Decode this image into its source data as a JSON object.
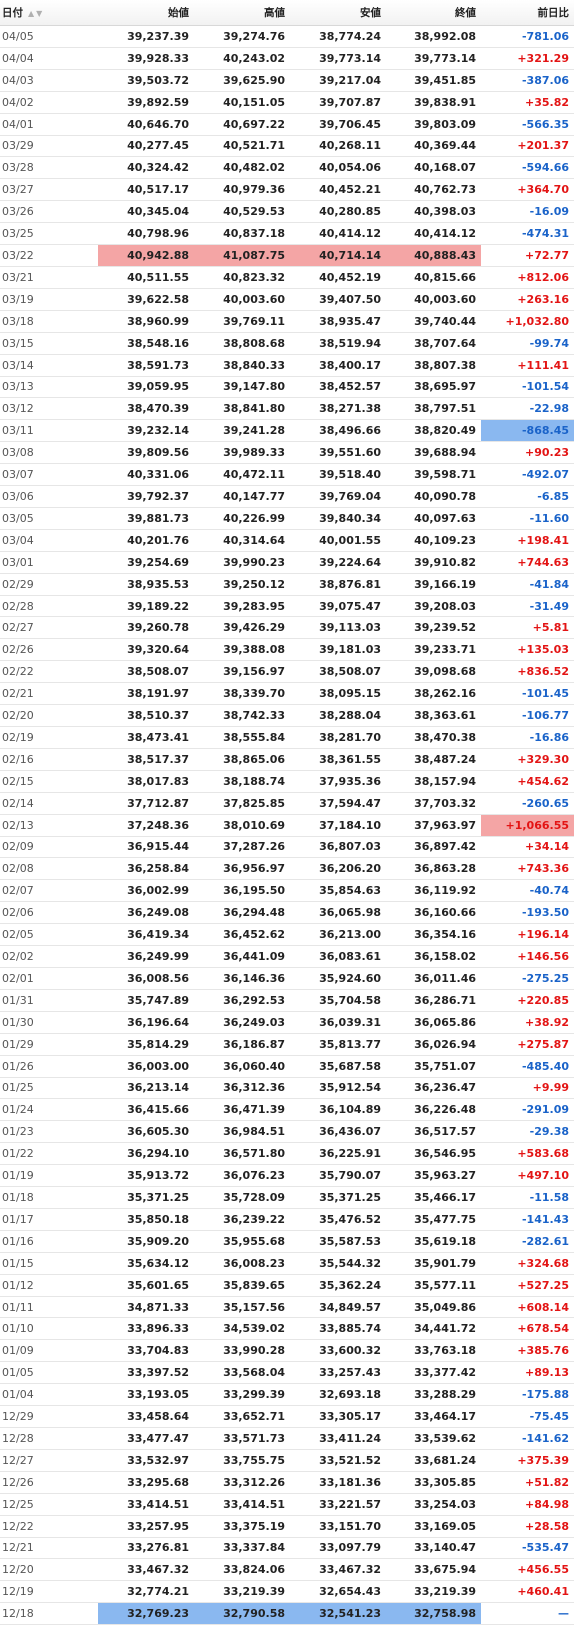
{
  "headers": {
    "date": "日付",
    "open": "始値",
    "high": "高値",
    "low": "安値",
    "close": "終値",
    "change": "前日比"
  },
  "sort_icons": [
    "sort-asc-icon",
    "sort-desc-icon"
  ],
  "colors": {
    "positive": "#e31414",
    "negative": "#1a63c9",
    "highlight_high": "#f4a5a5",
    "highlight_low": "#8ab8f0"
  },
  "rows": [
    {
      "date": "04/05",
      "open": "39,237.39",
      "high": "39,274.76",
      "low": "38,774.24",
      "close": "38,992.08",
      "change": "-781.06"
    },
    {
      "date": "04/04",
      "open": "39,928.33",
      "high": "40,243.02",
      "low": "39,773.14",
      "close": "39,773.14",
      "change": "+321.29"
    },
    {
      "date": "04/03",
      "open": "39,503.72",
      "high": "39,625.90",
      "low": "39,217.04",
      "close": "39,451.85",
      "change": "-387.06"
    },
    {
      "date": "04/02",
      "open": "39,892.59",
      "high": "40,151.05",
      "low": "39,707.87",
      "close": "39,838.91",
      "change": "+35.82"
    },
    {
      "date": "04/01",
      "open": "40,646.70",
      "high": "40,697.22",
      "low": "39,706.45",
      "close": "39,803.09",
      "change": "-566.35"
    },
    {
      "date": "03/29",
      "open": "40,277.45",
      "high": "40,521.71",
      "low": "40,268.11",
      "close": "40,369.44",
      "change": "+201.37"
    },
    {
      "date": "03/28",
      "open": "40,324.42",
      "high": "40,482.02",
      "low": "40,054.06",
      "close": "40,168.07",
      "change": "-594.66"
    },
    {
      "date": "03/27",
      "open": "40,517.17",
      "high": "40,979.36",
      "low": "40,452.21",
      "close": "40,762.73",
      "change": "+364.70"
    },
    {
      "date": "03/26",
      "open": "40,345.04",
      "high": "40,529.53",
      "low": "40,280.85",
      "close": "40,398.03",
      "change": "-16.09"
    },
    {
      "date": "03/25",
      "open": "40,798.96",
      "high": "40,837.18",
      "low": "40,414.12",
      "close": "40,414.12",
      "change": "-474.31"
    },
    {
      "date": "03/22",
      "open": "40,942.88",
      "high": "41,087.75",
      "low": "40,714.14",
      "close": "40,888.43",
      "change": "+72.77",
      "hl": "ohlc-red"
    },
    {
      "date": "03/21",
      "open": "40,511.55",
      "high": "40,823.32",
      "low": "40,452.19",
      "close": "40,815.66",
      "change": "+812.06"
    },
    {
      "date": "03/19",
      "open": "39,622.58",
      "high": "40,003.60",
      "low": "39,407.50",
      "close": "40,003.60",
      "change": "+263.16"
    },
    {
      "date": "03/18",
      "open": "38,960.99",
      "high": "39,769.11",
      "low": "38,935.47",
      "close": "39,740.44",
      "change": "+1,032.80"
    },
    {
      "date": "03/15",
      "open": "38,548.16",
      "high": "38,808.68",
      "low": "38,519.94",
      "close": "38,707.64",
      "change": "-99.74"
    },
    {
      "date": "03/14",
      "open": "38,591.73",
      "high": "38,840.33",
      "low": "38,400.17",
      "close": "38,807.38",
      "change": "+111.41"
    },
    {
      "date": "03/13",
      "open": "39,059.95",
      "high": "39,147.80",
      "low": "38,452.57",
      "close": "38,695.97",
      "change": "-101.54"
    },
    {
      "date": "03/12",
      "open": "38,470.39",
      "high": "38,841.80",
      "low": "38,271.38",
      "close": "38,797.51",
      "change": "-22.98"
    },
    {
      "date": "03/11",
      "open": "39,232.14",
      "high": "39,241.28",
      "low": "38,496.66",
      "close": "38,820.49",
      "change": "-868.45",
      "hl": "chg-blue"
    },
    {
      "date": "03/08",
      "open": "39,809.56",
      "high": "39,989.33",
      "low": "39,551.60",
      "close": "39,688.94",
      "change": "+90.23"
    },
    {
      "date": "03/07",
      "open": "40,331.06",
      "high": "40,472.11",
      "low": "39,518.40",
      "close": "39,598.71",
      "change": "-492.07"
    },
    {
      "date": "03/06",
      "open": "39,792.37",
      "high": "40,147.77",
      "low": "39,769.04",
      "close": "40,090.78",
      "change": "-6.85"
    },
    {
      "date": "03/05",
      "open": "39,881.73",
      "high": "40,226.99",
      "low": "39,840.34",
      "close": "40,097.63",
      "change": "-11.60"
    },
    {
      "date": "03/04",
      "open": "40,201.76",
      "high": "40,314.64",
      "low": "40,001.55",
      "close": "40,109.23",
      "change": "+198.41"
    },
    {
      "date": "03/01",
      "open": "39,254.69",
      "high": "39,990.23",
      "low": "39,224.64",
      "close": "39,910.82",
      "change": "+744.63"
    },
    {
      "date": "02/29",
      "open": "38,935.53",
      "high": "39,250.12",
      "low": "38,876.81",
      "close": "39,166.19",
      "change": "-41.84"
    },
    {
      "date": "02/28",
      "open": "39,189.22",
      "high": "39,283.95",
      "low": "39,075.47",
      "close": "39,208.03",
      "change": "-31.49"
    },
    {
      "date": "02/27",
      "open": "39,260.78",
      "high": "39,426.29",
      "low": "39,113.03",
      "close": "39,239.52",
      "change": "+5.81"
    },
    {
      "date": "02/26",
      "open": "39,320.64",
      "high": "39,388.08",
      "low": "39,181.03",
      "close": "39,233.71",
      "change": "+135.03"
    },
    {
      "date": "02/22",
      "open": "38,508.07",
      "high": "39,156.97",
      "low": "38,508.07",
      "close": "39,098.68",
      "change": "+836.52"
    },
    {
      "date": "02/21",
      "open": "38,191.97",
      "high": "38,339.70",
      "low": "38,095.15",
      "close": "38,262.16",
      "change": "-101.45"
    },
    {
      "date": "02/20",
      "open": "38,510.37",
      "high": "38,742.33",
      "low": "38,288.04",
      "close": "38,363.61",
      "change": "-106.77"
    },
    {
      "date": "02/19",
      "open": "38,473.41",
      "high": "38,555.84",
      "low": "38,281.70",
      "close": "38,470.38",
      "change": "-16.86"
    },
    {
      "date": "02/16",
      "open": "38,517.37",
      "high": "38,865.06",
      "low": "38,361.55",
      "close": "38,487.24",
      "change": "+329.30"
    },
    {
      "date": "02/15",
      "open": "38,017.83",
      "high": "38,188.74",
      "low": "37,935.36",
      "close": "38,157.94",
      "change": "+454.62"
    },
    {
      "date": "02/14",
      "open": "37,712.87",
      "high": "37,825.85",
      "low": "37,594.47",
      "close": "37,703.32",
      "change": "-260.65"
    },
    {
      "date": "02/13",
      "open": "37,248.36",
      "high": "38,010.69",
      "low": "37,184.10",
      "close": "37,963.97",
      "change": "+1,066.55",
      "hl": "chg-red"
    },
    {
      "date": "02/09",
      "open": "36,915.44",
      "high": "37,287.26",
      "low": "36,807.03",
      "close": "36,897.42",
      "change": "+34.14"
    },
    {
      "date": "02/08",
      "open": "36,258.84",
      "high": "36,956.97",
      "low": "36,206.20",
      "close": "36,863.28",
      "change": "+743.36"
    },
    {
      "date": "02/07",
      "open": "36,002.99",
      "high": "36,195.50",
      "low": "35,854.63",
      "close": "36,119.92",
      "change": "-40.74"
    },
    {
      "date": "02/06",
      "open": "36,249.08",
      "high": "36,294.48",
      "low": "36,065.98",
      "close": "36,160.66",
      "change": "-193.50"
    },
    {
      "date": "02/05",
      "open": "36,419.34",
      "high": "36,452.62",
      "low": "36,213.00",
      "close": "36,354.16",
      "change": "+196.14"
    },
    {
      "date": "02/02",
      "open": "36,249.99",
      "high": "36,441.09",
      "low": "36,083.61",
      "close": "36,158.02",
      "change": "+146.56"
    },
    {
      "date": "02/01",
      "open": "36,008.56",
      "high": "36,146.36",
      "low": "35,924.60",
      "close": "36,011.46",
      "change": "-275.25"
    },
    {
      "date": "01/31",
      "open": "35,747.89",
      "high": "36,292.53",
      "low": "35,704.58",
      "close": "36,286.71",
      "change": "+220.85"
    },
    {
      "date": "01/30",
      "open": "36,196.64",
      "high": "36,249.03",
      "low": "36,039.31",
      "close": "36,065.86",
      "change": "+38.92"
    },
    {
      "date": "01/29",
      "open": "35,814.29",
      "high": "36,186.87",
      "low": "35,813.77",
      "close": "36,026.94",
      "change": "+275.87"
    },
    {
      "date": "01/26",
      "open": "36,003.00",
      "high": "36,060.40",
      "low": "35,687.58",
      "close": "35,751.07",
      "change": "-485.40"
    },
    {
      "date": "01/25",
      "open": "36,213.14",
      "high": "36,312.36",
      "low": "35,912.54",
      "close": "36,236.47",
      "change": "+9.99"
    },
    {
      "date": "01/24",
      "open": "36,415.66",
      "high": "36,471.39",
      "low": "36,104.89",
      "close": "36,226.48",
      "change": "-291.09"
    },
    {
      "date": "01/23",
      "open": "36,605.30",
      "high": "36,984.51",
      "low": "36,436.07",
      "close": "36,517.57",
      "change": "-29.38"
    },
    {
      "date": "01/22",
      "open": "36,294.10",
      "high": "36,571.80",
      "low": "36,225.91",
      "close": "36,546.95",
      "change": "+583.68"
    },
    {
      "date": "01/19",
      "open": "35,913.72",
      "high": "36,076.23",
      "low": "35,790.07",
      "close": "35,963.27",
      "change": "+497.10"
    },
    {
      "date": "01/18",
      "open": "35,371.25",
      "high": "35,728.09",
      "low": "35,371.25",
      "close": "35,466.17",
      "change": "-11.58"
    },
    {
      "date": "01/17",
      "open": "35,850.18",
      "high": "36,239.22",
      "low": "35,476.52",
      "close": "35,477.75",
      "change": "-141.43"
    },
    {
      "date": "01/16",
      "open": "35,909.20",
      "high": "35,955.68",
      "low": "35,587.53",
      "close": "35,619.18",
      "change": "-282.61"
    },
    {
      "date": "01/15",
      "open": "35,634.12",
      "high": "36,008.23",
      "low": "35,544.32",
      "close": "35,901.79",
      "change": "+324.68"
    },
    {
      "date": "01/12",
      "open": "35,601.65",
      "high": "35,839.65",
      "low": "35,362.24",
      "close": "35,577.11",
      "change": "+527.25"
    },
    {
      "date": "01/11",
      "open": "34,871.33",
      "high": "35,157.56",
      "low": "34,849.57",
      "close": "35,049.86",
      "change": "+608.14"
    },
    {
      "date": "01/10",
      "open": "33,896.33",
      "high": "34,539.02",
      "low": "33,885.74",
      "close": "34,441.72",
      "change": "+678.54"
    },
    {
      "date": "01/09",
      "open": "33,704.83",
      "high": "33,990.28",
      "low": "33,600.32",
      "close": "33,763.18",
      "change": "+385.76"
    },
    {
      "date": "01/05",
      "open": "33,397.52",
      "high": "33,568.04",
      "low": "33,257.43",
      "close": "33,377.42",
      "change": "+89.13"
    },
    {
      "date": "01/04",
      "open": "33,193.05",
      "high": "33,299.39",
      "low": "32,693.18",
      "close": "33,288.29",
      "change": "-175.88"
    },
    {
      "date": "12/29",
      "open": "33,458.64",
      "high": "33,652.71",
      "low": "33,305.17",
      "close": "33,464.17",
      "change": "-75.45"
    },
    {
      "date": "12/28",
      "open": "33,477.47",
      "high": "33,571.73",
      "low": "33,411.24",
      "close": "33,539.62",
      "change": "-141.62"
    },
    {
      "date": "12/27",
      "open": "33,532.97",
      "high": "33,755.75",
      "low": "33,521.52",
      "close": "33,681.24",
      "change": "+375.39"
    },
    {
      "date": "12/26",
      "open": "33,295.68",
      "high": "33,312.26",
      "low": "33,181.36",
      "close": "33,305.85",
      "change": "+51.82"
    },
    {
      "date": "12/25",
      "open": "33,414.51",
      "high": "33,414.51",
      "low": "33,221.57",
      "close": "33,254.03",
      "change": "+84.98"
    },
    {
      "date": "12/22",
      "open": "33,257.95",
      "high": "33,375.19",
      "low": "33,151.70",
      "close": "33,169.05",
      "change": "+28.58"
    },
    {
      "date": "12/21",
      "open": "33,276.81",
      "high": "33,337.84",
      "low": "33,097.79",
      "close": "33,140.47",
      "change": "-535.47"
    },
    {
      "date": "12/20",
      "open": "33,467.32",
      "high": "33,824.06",
      "low": "33,467.32",
      "close": "33,675.94",
      "change": "+456.55"
    },
    {
      "date": "12/19",
      "open": "32,774.21",
      "high": "33,219.39",
      "low": "32,654.43",
      "close": "33,219.39",
      "change": "+460.41"
    },
    {
      "date": "12/18",
      "open": "32,769.23",
      "high": "32,790.58",
      "low": "32,541.23",
      "close": "32,758.98",
      "change": "—",
      "hl": "ohlc-blue"
    }
  ]
}
